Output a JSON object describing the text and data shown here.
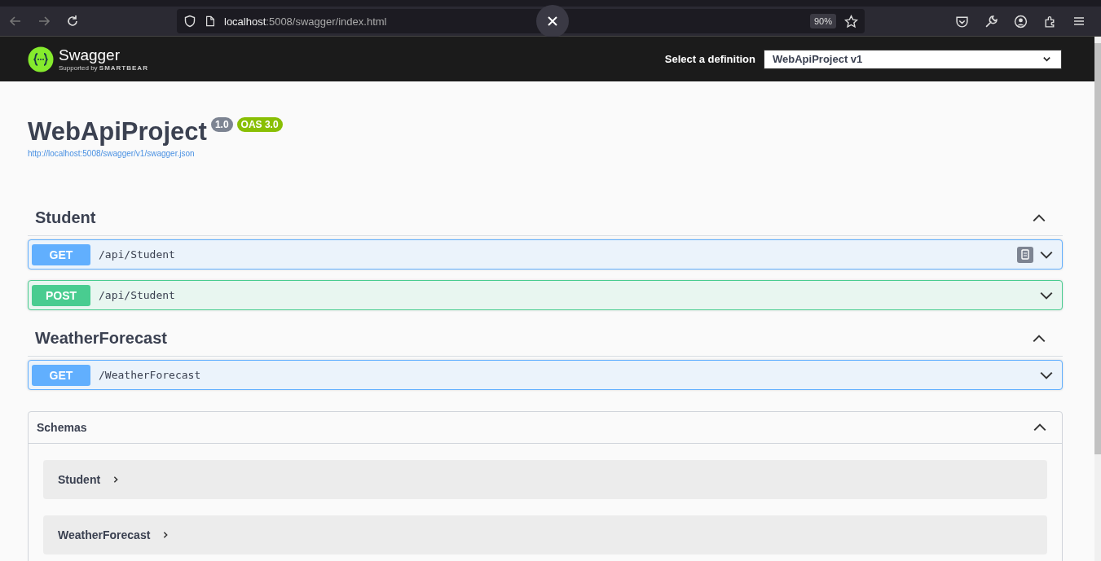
{
  "browser": {
    "url_host": "localhost",
    "url_path": ":5008/swagger/index.html",
    "zoom": "90%"
  },
  "header": {
    "logo_text": "Swagger",
    "logo_sub": "Supported by",
    "logo_brand": "SMARTBEAR",
    "select_label": "Select a definition",
    "select_value": "WebApiProject v1"
  },
  "info": {
    "title": "WebApiProject",
    "version": "1.0",
    "oas": "OAS 3.0",
    "spec_url": "http://localhost:5008/swagger/v1/swagger.json"
  },
  "sections": [
    {
      "name": "Student",
      "expanded": true,
      "operations": [
        {
          "kind": "get",
          "method": "GET",
          "path": "/api/Student",
          "hovered": true
        },
        {
          "kind": "post",
          "method": "POST",
          "path": "/api/Student",
          "hovered": false
        }
      ]
    },
    {
      "name": "WeatherForecast",
      "expanded": true,
      "operations": [
        {
          "kind": "get",
          "method": "GET",
          "path": "/WeatherForecast",
          "hovered": false
        }
      ]
    }
  ],
  "schemas": {
    "title": "Schemas",
    "expanded": true,
    "items": [
      "Student",
      "WeatherForecast"
    ]
  }
}
